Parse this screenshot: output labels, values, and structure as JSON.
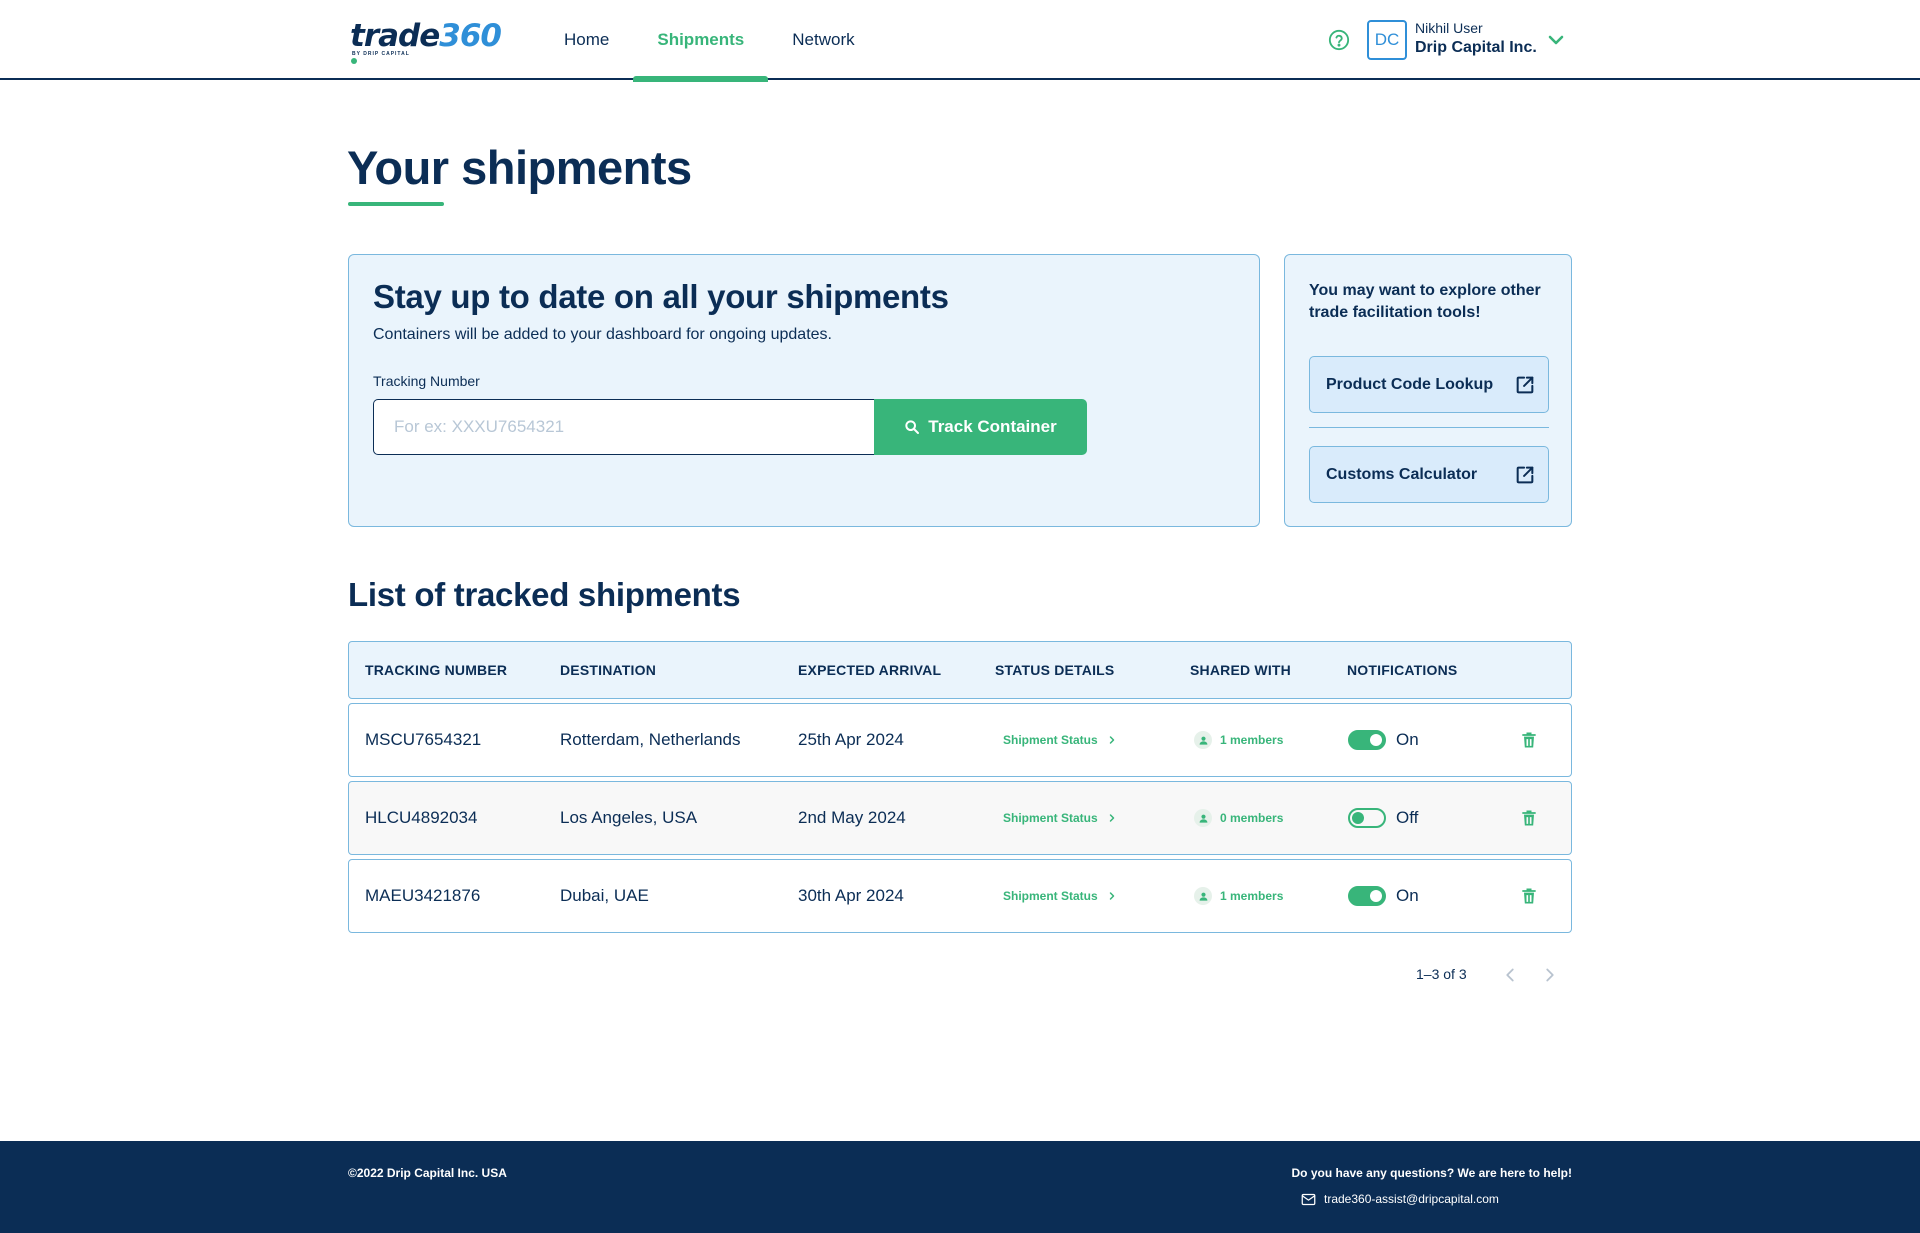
{
  "brand": {
    "logo_main": "trade",
    "logo_num": "360",
    "logo_sub": "BY DRIP CAPITAL"
  },
  "nav": {
    "home": "Home",
    "shipments": "Shipments",
    "network": "Network"
  },
  "user": {
    "initials": "DC",
    "name": "Nikhil User",
    "company": "Drip Capital Inc."
  },
  "page": {
    "title": "Your shipments"
  },
  "tracking": {
    "heading": "Stay up to date on all your shipments",
    "subtext": "Containers will be added to your dashboard for ongoing updates.",
    "field_label": "Tracking Number",
    "placeholder": "For ex: XXXU7654321",
    "button": "Track Container"
  },
  "tools": {
    "intro": "You may want to explore other trade facilitation tools!",
    "product_code": "Product Code Lookup",
    "customs": "Customs Calculator"
  },
  "list": {
    "title": "List of tracked shipments",
    "headers": {
      "tracking": "TRACKING NUMBER",
      "destination": "DESTINATION",
      "arrival": "EXPECTED ARRIVAL",
      "status": "STATUS DETAILS",
      "shared": "SHARED WITH",
      "notifications": "NOTIFICATIONS"
    },
    "rows": [
      {
        "tracking": "MSCU7654321",
        "destination": "Rotterdam, Netherlands",
        "arrival": "25th Apr 2024",
        "status": "Shipment Status",
        "shared": "1 members",
        "notif": "On"
      },
      {
        "tracking": "HLCU4892034",
        "destination": "Los Angeles, USA",
        "arrival": "2nd May 2024",
        "status": "Shipment Status",
        "shared": "0 members",
        "notif": "Off"
      },
      {
        "tracking": "MAEU3421876",
        "destination": "Dubai, UAE",
        "arrival": "30th Apr 2024",
        "status": "Shipment Status",
        "shared": "1 members",
        "notif": "On"
      }
    ],
    "pagination": "1–3 of 3"
  },
  "footer": {
    "copyright": "©2022 Drip Capital Inc. USA",
    "help": "Do you have any questions? We are here to help!",
    "email": "trade360-assist@dripcapital.com"
  },
  "colors": {
    "navy": "#0b2d55",
    "green": "#38b57a",
    "light_blue": "#eaf4fc",
    "border_blue": "#7ab8de",
    "logo_blue": "#2f8fd8"
  },
  "icons": [
    "help-circle-icon",
    "chevron-down-icon",
    "search-icon",
    "external-link-icon",
    "chevron-right-icon",
    "person-icon",
    "trash-icon",
    "mail-icon"
  ]
}
